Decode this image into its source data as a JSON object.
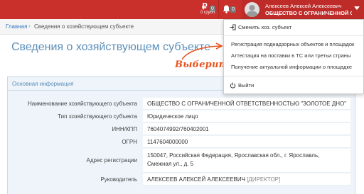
{
  "topbar": {
    "ruble_symbol": "₽",
    "ruble_badge": "0",
    "ruble_sub": "0 групп",
    "bell_badge": "0",
    "user_name": "Алексеев Алексей Алексеевич",
    "user_org": "ОБЩЕСТВО С ОГРАНИЧЕННОЙ ОТВЕ"
  },
  "breadcrumb": {
    "home": "Главная",
    "separator": "›",
    "current": "Сведения о хозяйствующем субъекте"
  },
  "page": {
    "title": "Сведения о хозяйствующем субъекте"
  },
  "dropdown": {
    "switch_label": "Сменить хоз. субъект",
    "items": [
      "Регистрация поднадзорных объектов и площадок",
      "Аттестация на поставки в ТС или третьи страны",
      "Получение актуальной информации о площадке"
    ],
    "logout_label": "Выйти"
  },
  "annotation": {
    "text": "Выберите"
  },
  "panel": {
    "title": "Основная информация",
    "rows": [
      {
        "label": "Наименование хозяйствующего субъекта",
        "value": "ОБЩЕСТВО С ОГРАНИЧЕННОЙ ОТВЕТСТВЕННОСТЬЮ \"ЗОЛОТОЕ ДНО\""
      },
      {
        "label": "Тип хозяйствующего субъекта",
        "value": "Юридическое лицо"
      },
      {
        "label": "ИНН/КПП",
        "value": "7604074992/760402001"
      },
      {
        "label": "ОГРН",
        "value": "1147604000000"
      },
      {
        "label": "Адрес регистрации",
        "value": "150047, Российская Федерация, Ярославская обл., г. Ярославль,",
        "value2": "Смежная ул., д. 5"
      },
      {
        "label": "Руководитель",
        "value": "АЛЕКСЕЕВ АЛЕКСЕЙ АЛЕКСЕЕВИЧ",
        "hint": "[ДИРЕКТОР]"
      }
    ]
  },
  "colors": {
    "topbar": "#c9302c",
    "link": "#3a7bbf",
    "title": "#5b8fb9",
    "annotation": "#e8541f",
    "panel_bg": "#eef4fa"
  },
  "icons": [
    "ruble-icon",
    "bell-icon",
    "avatar",
    "caret-down-icon",
    "sign-in-icon",
    "power-icon",
    "annotation-arrow"
  ]
}
